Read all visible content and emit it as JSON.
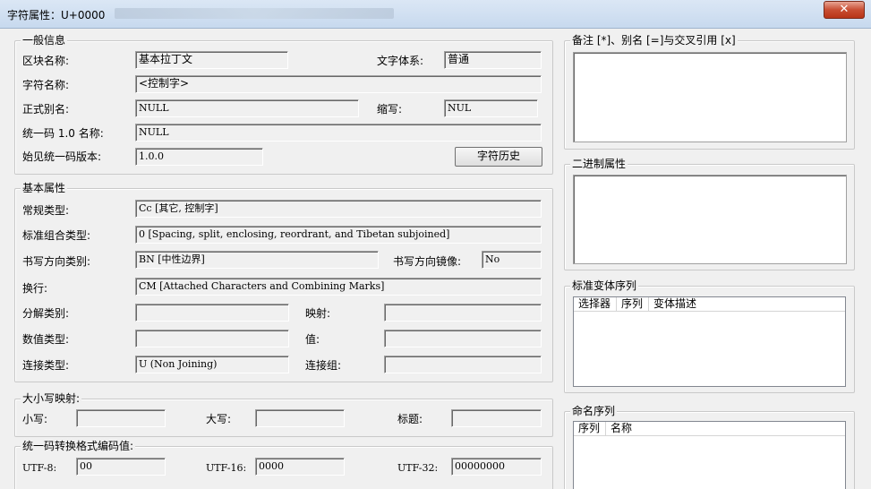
{
  "window": {
    "title": "字符属性：U+0000",
    "close_glyph": "✕"
  },
  "general": {
    "legend": "一般信息",
    "block_name_label": "区块名称:",
    "block_name_value": "基本拉丁文",
    "script_label": "文字体系:",
    "script_value": "普通",
    "char_name_label": "字符名称:",
    "char_name_value": "<控制字>",
    "formal_alias_label": "正式别名:",
    "formal_alias_value": "NULL",
    "abbrev_label": "缩写:",
    "abbrev_value": "NUL",
    "unicode1_name_label": "统一码 1.0 名称:",
    "unicode1_name_value": "NULL",
    "first_version_label": "始见统一码版本:",
    "first_version_value": "1.0.0",
    "history_button": "字符历史"
  },
  "basic": {
    "legend": "基本属性",
    "general_category_label": "常规类型:",
    "general_category_value": "Cc [其它, 控制字]",
    "combining_class_label": "标准组合类型:",
    "combining_class_value": "0 [Spacing, split, enclosing, reordrant, and Tibetan subjoined]",
    "bidi_class_label": "书写方向类别:",
    "bidi_class_value": "BN [中性边界]",
    "bidi_mirror_label": "书写方向镜像:",
    "bidi_mirror_value": "No",
    "line_break_label": "换行:",
    "line_break_value": "CM [Attached Characters and Combining Marks]",
    "decomp_type_label": "分解类别:",
    "decomp_type_value": "",
    "mapping_label": "映射:",
    "mapping_value": "",
    "numeric_type_label": "数值类型:",
    "numeric_type_value": "",
    "value_label": "值:",
    "value_value": "",
    "joining_type_label": "连接类型:",
    "joining_type_value": "U (Non Joining)",
    "joining_group_label": "连接组:",
    "joining_group_value": ""
  },
  "case": {
    "legend": "大小写映射:",
    "lower_label": "小写:",
    "lower_value": "",
    "upper_label": "大写:",
    "upper_value": "",
    "title_label": "标题:",
    "title_value": ""
  },
  "utf": {
    "legend": "统一码转换格式编码值:",
    "utf8_label": "UTF-8:",
    "utf8_value": "00",
    "utf16_label": "UTF-16:",
    "utf16_value": "0000",
    "utf32_label": "UTF-32:",
    "utf32_value": "00000000"
  },
  "right": {
    "notes_legend": "备注 [*]、别名 [=]与交叉引用 [x]",
    "binary_legend": "二进制属性",
    "variation_legend": "标准变体序列",
    "variation_columns": [
      "选择器",
      "序列",
      "变体描述"
    ],
    "named_legend": "命名序列",
    "named_columns": [
      "序列",
      "名称"
    ]
  }
}
